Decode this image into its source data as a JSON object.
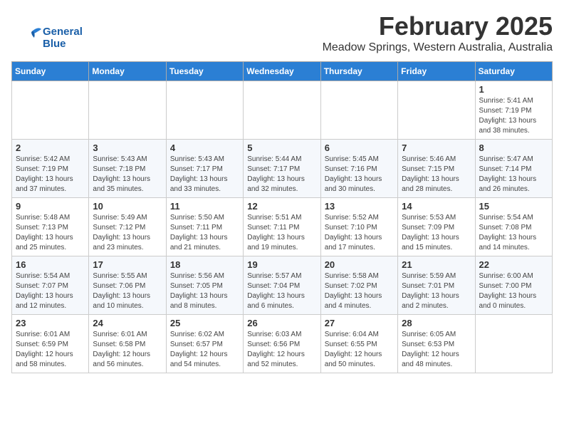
{
  "logo": {
    "line1": "General",
    "line2": "Blue"
  },
  "header": {
    "month": "February 2025",
    "location": "Meadow Springs, Western Australia, Australia"
  },
  "days_of_week": [
    "Sunday",
    "Monday",
    "Tuesday",
    "Wednesday",
    "Thursday",
    "Friday",
    "Saturday"
  ],
  "weeks": [
    [
      {
        "day": "",
        "info": ""
      },
      {
        "day": "",
        "info": ""
      },
      {
        "day": "",
        "info": ""
      },
      {
        "day": "",
        "info": ""
      },
      {
        "day": "",
        "info": ""
      },
      {
        "day": "",
        "info": ""
      },
      {
        "day": "1",
        "info": "Sunrise: 5:41 AM\nSunset: 7:19 PM\nDaylight: 13 hours\nand 38 minutes."
      }
    ],
    [
      {
        "day": "2",
        "info": "Sunrise: 5:42 AM\nSunset: 7:19 PM\nDaylight: 13 hours\nand 37 minutes."
      },
      {
        "day": "3",
        "info": "Sunrise: 5:43 AM\nSunset: 7:18 PM\nDaylight: 13 hours\nand 35 minutes."
      },
      {
        "day": "4",
        "info": "Sunrise: 5:43 AM\nSunset: 7:17 PM\nDaylight: 13 hours\nand 33 minutes."
      },
      {
        "day": "5",
        "info": "Sunrise: 5:44 AM\nSunset: 7:17 PM\nDaylight: 13 hours\nand 32 minutes."
      },
      {
        "day": "6",
        "info": "Sunrise: 5:45 AM\nSunset: 7:16 PM\nDaylight: 13 hours\nand 30 minutes."
      },
      {
        "day": "7",
        "info": "Sunrise: 5:46 AM\nSunset: 7:15 PM\nDaylight: 13 hours\nand 28 minutes."
      },
      {
        "day": "8",
        "info": "Sunrise: 5:47 AM\nSunset: 7:14 PM\nDaylight: 13 hours\nand 26 minutes."
      }
    ],
    [
      {
        "day": "9",
        "info": "Sunrise: 5:48 AM\nSunset: 7:13 PM\nDaylight: 13 hours\nand 25 minutes."
      },
      {
        "day": "10",
        "info": "Sunrise: 5:49 AM\nSunset: 7:12 PM\nDaylight: 13 hours\nand 23 minutes."
      },
      {
        "day": "11",
        "info": "Sunrise: 5:50 AM\nSunset: 7:11 PM\nDaylight: 13 hours\nand 21 minutes."
      },
      {
        "day": "12",
        "info": "Sunrise: 5:51 AM\nSunset: 7:11 PM\nDaylight: 13 hours\nand 19 minutes."
      },
      {
        "day": "13",
        "info": "Sunrise: 5:52 AM\nSunset: 7:10 PM\nDaylight: 13 hours\nand 17 minutes."
      },
      {
        "day": "14",
        "info": "Sunrise: 5:53 AM\nSunset: 7:09 PM\nDaylight: 13 hours\nand 15 minutes."
      },
      {
        "day": "15",
        "info": "Sunrise: 5:54 AM\nSunset: 7:08 PM\nDaylight: 13 hours\nand 14 minutes."
      }
    ],
    [
      {
        "day": "16",
        "info": "Sunrise: 5:54 AM\nSunset: 7:07 PM\nDaylight: 13 hours\nand 12 minutes."
      },
      {
        "day": "17",
        "info": "Sunrise: 5:55 AM\nSunset: 7:06 PM\nDaylight: 13 hours\nand 10 minutes."
      },
      {
        "day": "18",
        "info": "Sunrise: 5:56 AM\nSunset: 7:05 PM\nDaylight: 13 hours\nand 8 minutes."
      },
      {
        "day": "19",
        "info": "Sunrise: 5:57 AM\nSunset: 7:04 PM\nDaylight: 13 hours\nand 6 minutes."
      },
      {
        "day": "20",
        "info": "Sunrise: 5:58 AM\nSunset: 7:02 PM\nDaylight: 13 hours\nand 4 minutes."
      },
      {
        "day": "21",
        "info": "Sunrise: 5:59 AM\nSunset: 7:01 PM\nDaylight: 13 hours\nand 2 minutes."
      },
      {
        "day": "22",
        "info": "Sunrise: 6:00 AM\nSunset: 7:00 PM\nDaylight: 13 hours\nand 0 minutes."
      }
    ],
    [
      {
        "day": "23",
        "info": "Sunrise: 6:01 AM\nSunset: 6:59 PM\nDaylight: 12 hours\nand 58 minutes."
      },
      {
        "day": "24",
        "info": "Sunrise: 6:01 AM\nSunset: 6:58 PM\nDaylight: 12 hours\nand 56 minutes."
      },
      {
        "day": "25",
        "info": "Sunrise: 6:02 AM\nSunset: 6:57 PM\nDaylight: 12 hours\nand 54 minutes."
      },
      {
        "day": "26",
        "info": "Sunrise: 6:03 AM\nSunset: 6:56 PM\nDaylight: 12 hours\nand 52 minutes."
      },
      {
        "day": "27",
        "info": "Sunrise: 6:04 AM\nSunset: 6:55 PM\nDaylight: 12 hours\nand 50 minutes."
      },
      {
        "day": "28",
        "info": "Sunrise: 6:05 AM\nSunset: 6:53 PM\nDaylight: 12 hours\nand 48 minutes."
      },
      {
        "day": "",
        "info": ""
      }
    ]
  ]
}
